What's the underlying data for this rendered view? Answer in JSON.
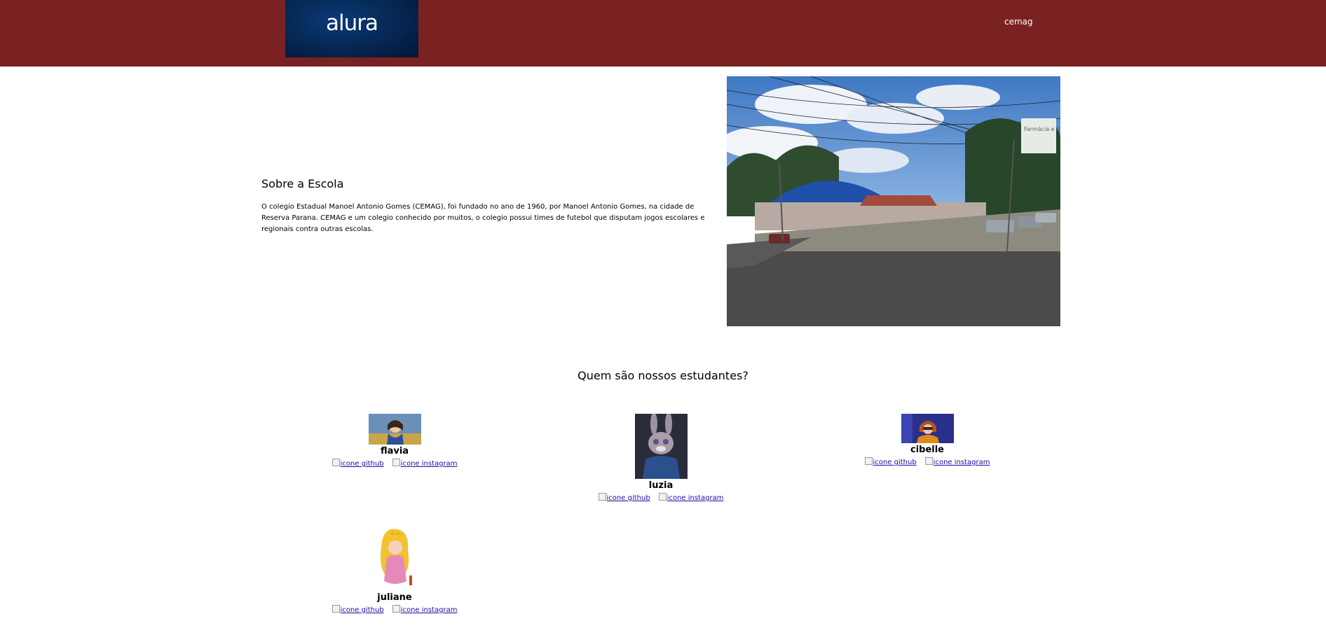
{
  "header": {
    "logo_text": "alura",
    "nav_link": "cemag"
  },
  "about": {
    "title": "Sobre a Escola",
    "text": "O colegio Estadual Manoel Antonio Gomes (CEMAG), foi fundado no ano de 1960, por Manoel Antonio Gomes, na cidade de Reserva Parana. CEMAG e um colegio conhecido por muitos, o colegio possui times de futebol que disputam jogos escolares e regionais contra outras escolas.",
    "photo_sign": "Farmácia e Mani"
  },
  "students": {
    "title": "Quem são nossos estudantes?",
    "list": [
      {
        "name": "flavia",
        "github_alt": "icone github",
        "instagram_alt": "icone instagram"
      },
      {
        "name": "luzia",
        "github_alt": "icone github",
        "instagram_alt": "icone instagram"
      },
      {
        "name": "cibelle",
        "github_alt": "icone github",
        "instagram_alt": "icone instagram"
      },
      {
        "name": "juliane",
        "github_alt": "icone github",
        "instagram_alt": "icone instagram"
      }
    ]
  },
  "colors": {
    "header_bg": "#7a2222",
    "logo_bg": "#062a58",
    "link": "#1a0dab"
  }
}
